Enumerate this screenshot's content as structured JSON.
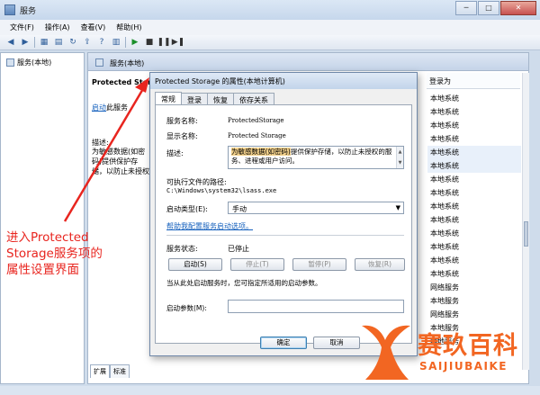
{
  "window": {
    "title": "服务",
    "btn_min": "─",
    "btn_max": "□",
    "btn_close": "✕"
  },
  "menu": [
    "文件(F)",
    "操作(A)",
    "查看(V)",
    "帮助(H)"
  ],
  "tree": {
    "item": "服务(本地)"
  },
  "panel": {
    "header": "服务(本地)",
    "desc_title": "Protected Storage",
    "start_link": "启动",
    "start_suffix": "此服务",
    "desc_label": "描述:",
    "desc_text": "为敏感数据(如密码)提供保护存储，以防止未授权的服务",
    "column_header": "登录为",
    "logon_rows": [
      "本地系统",
      "本地系统",
      "本地系统",
      "本地系统",
      "本地系统",
      "本地系统",
      "本地系统",
      "本地系统",
      "本地系统",
      "本地系统",
      "本地系统",
      "本地系统",
      "本地系统",
      "本地系统",
      "网络服务",
      "本地服务",
      "网络服务",
      "本地服务",
      "本地服务"
    ],
    "tabs": [
      "扩展",
      "标准"
    ]
  },
  "dialog": {
    "title": "Protected Storage 的属性(本地计算机)",
    "tabs": [
      "常规",
      "登录",
      "恢复",
      "依存关系"
    ],
    "service_name_label": "服务名称:",
    "service_name": "ProtectedStorage",
    "display_name_label": "显示名称:",
    "display_name": "Protected Storage",
    "description_label": "描述:",
    "description_selected": "为敏感数据(如密码)",
    "description_rest": "提供保护存储，以防止未授权的服务、进程或用户访问。",
    "path_label": "可执行文件的路径:",
    "path_value": "C:\\Windows\\system32\\lsass.exe",
    "startup_label": "启动类型(E):",
    "startup_value": "手动",
    "help_link": "帮助我配置服务启动选项。",
    "status_label": "服务状态:",
    "status_value": "已停止",
    "buttons": {
      "start": "启动(S)",
      "stop": "停止(T)",
      "pause": "暂停(P)",
      "resume": "恢复(R)",
      "ok": "确定",
      "cancel": "取消"
    },
    "note": "当从此处启动服务时，您可指定所适用的启动参数。",
    "param_label": "启动参数(M):"
  },
  "annotation": {
    "line1": "进入Protected",
    "line2": " Storage服务项的",
    "line3": "属性设置界面",
    "color": "#e8251f"
  },
  "watermark": {
    "brand": "赛玖百科",
    "sub": "SAIJIUBAIKE",
    "color": "#f26622"
  }
}
